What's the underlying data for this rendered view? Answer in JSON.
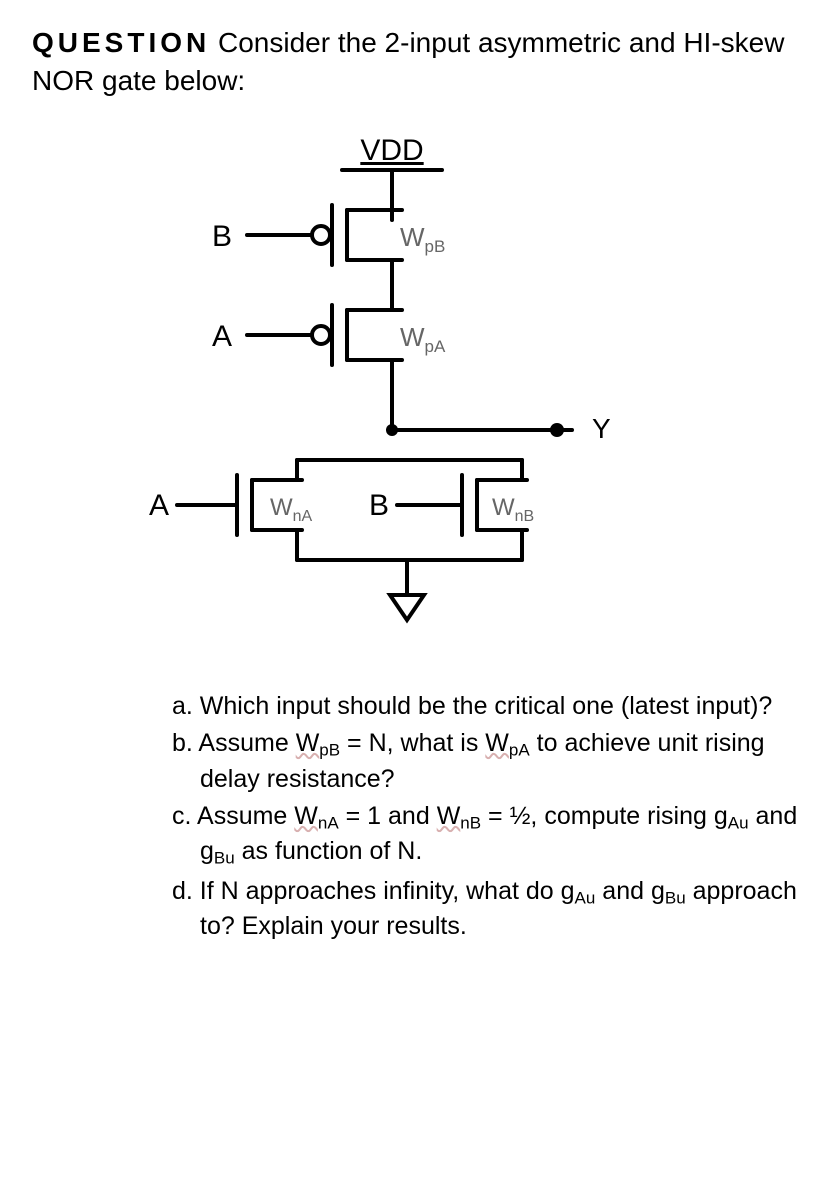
{
  "question": {
    "lead": "QUESTION",
    "prompt_rest": " Consider the 2-input asymmetric and HI-skew NOR gate below:"
  },
  "diagram": {
    "vdd": "VDD",
    "input_B_top": "B",
    "label_WpB_base": "W",
    "label_WpB_sub": "pB",
    "input_A_mid": "A",
    "label_WpA_base": "W",
    "label_WpA_sub": "pA",
    "output_Y": "Y",
    "input_A_bottom": "A",
    "label_WnA_base": "W",
    "label_WnA_sub": "nA",
    "input_B_bottom": "B",
    "label_WnB_base": "W",
    "label_WnB_sub": "nB"
  },
  "parts": {
    "a_lead": "a. ",
    "a_text": "Which input should be the critical one (latest input)?",
    "b_lead": "b. ",
    "b_1": "Assume ",
    "b_WpB_base": "W",
    "b_WpB_sub": "pB",
    "b_2": " = N, what is ",
    "b_WpA_base": "W",
    "b_WpA_sub": "pA",
    "b_3": " to achieve unit rising delay resistance?",
    "c_lead": "c. ",
    "c_1": "Assume ",
    "c_WnA_base": "W",
    "c_WnA_sub": "nA",
    "c_2": " = 1 and ",
    "c_WnB_base": "W",
    "c_WnB_sub": "nB",
    "c_3": " = ½, compute rising ",
    "c_gAu_base": "g",
    "c_gAu_sub": "Au",
    "c_4": " and ",
    "c_gBu_base": "g",
    "c_gBu_sub": "Bu",
    "c_5": " as function of N.",
    "d_lead": "d. ",
    "d_1": "If N approaches infinity, what do ",
    "d_gAu_base": "g",
    "d_gAu_sub": "Au",
    "d_2": " and ",
    "d_gBu_base": "g",
    "d_gBu_sub": "Bu",
    "d_3": " approach to? Explain your results."
  }
}
